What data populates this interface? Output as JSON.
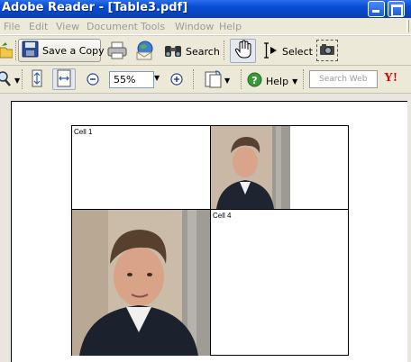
{
  "window": {
    "title": "Adobe Reader - [Table3.pdf]"
  },
  "menu": {
    "items": [
      "File",
      "Edit",
      "View",
      "Document",
      "Tools",
      "Window",
      "Help"
    ]
  },
  "toolbar1": {
    "save_copy_label": "Save a Copy",
    "search_label": "Search",
    "select_label": "Select"
  },
  "toolbar2": {
    "zoom_value": "55%",
    "help_label": "Help",
    "search_web_placeholder": "Search Web",
    "yahoo_label": "Y!"
  },
  "document": {
    "cells": [
      {
        "label": "Cell 1"
      },
      {
        "label": ""
      },
      {
        "label": ""
      },
      {
        "label": "Cell 4"
      }
    ]
  },
  "colors": {
    "titlebar": "#0a4ed6",
    "menubar": "#ece9d8",
    "toolbar": "#ece9d8",
    "disabled_text": "#9b9b9b"
  }
}
